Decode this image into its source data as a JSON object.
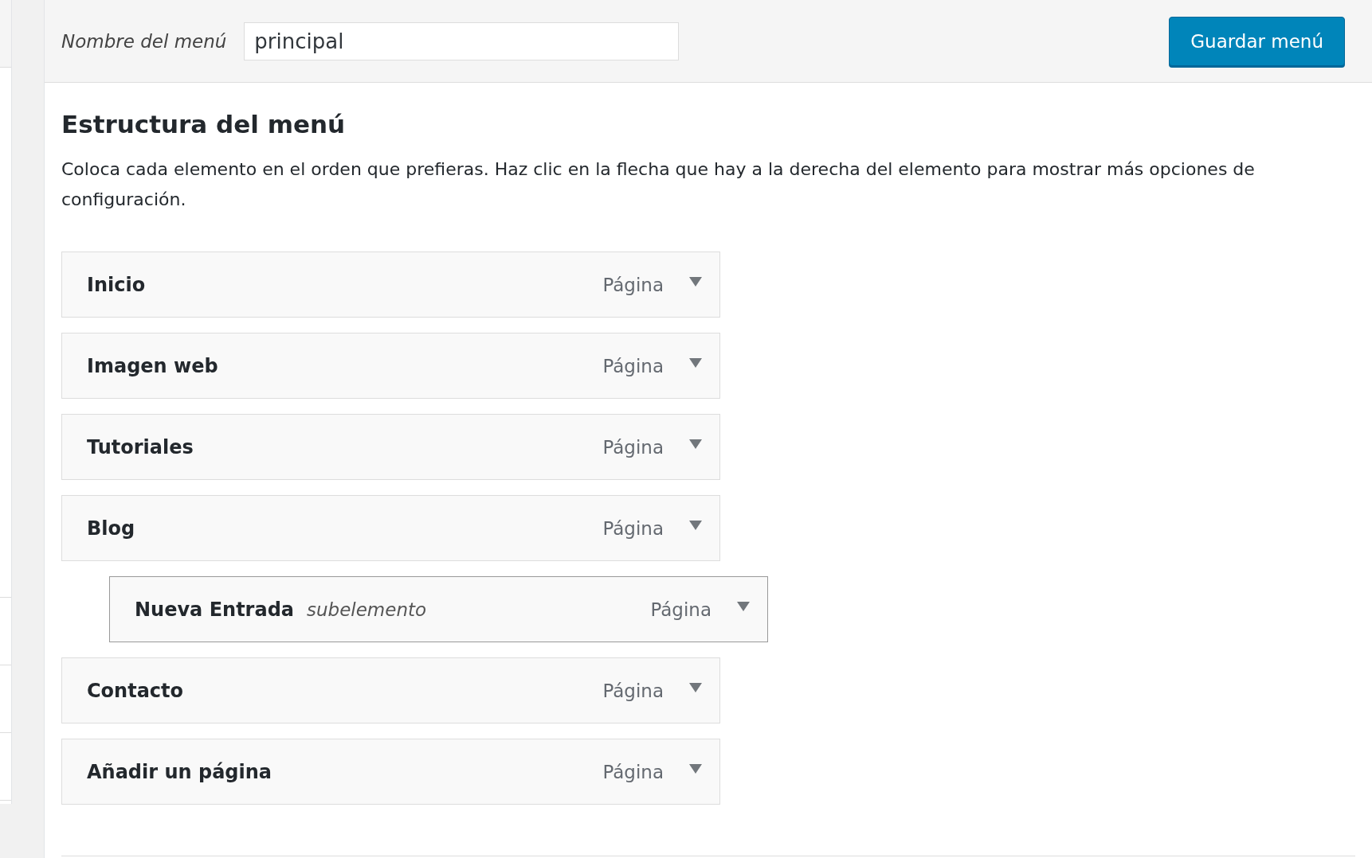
{
  "header": {
    "label": "Nombre del menú",
    "menu_name": "principal",
    "save_button": "Guardar menú"
  },
  "structure": {
    "title": "Estructura del menú",
    "description": "Coloca cada elemento en el orden que prefieras. Haz clic en la flecha que hay a la derecha del elemento para mostrar más opciones de configuración.",
    "items": [
      {
        "title": "Inicio",
        "type": "Página"
      },
      {
        "title": "Imagen web",
        "type": "Página"
      },
      {
        "title": "Tutoriales",
        "type": "Página"
      },
      {
        "title": "Blog",
        "type": "Página",
        "children": [
          {
            "title": "Nueva Entrada",
            "sublabel": "subelemento",
            "type": "Página"
          }
        ]
      },
      {
        "title": "Contacto",
        "type": "Página"
      },
      {
        "title": "Añadir un página",
        "type": "Página"
      }
    ]
  }
}
